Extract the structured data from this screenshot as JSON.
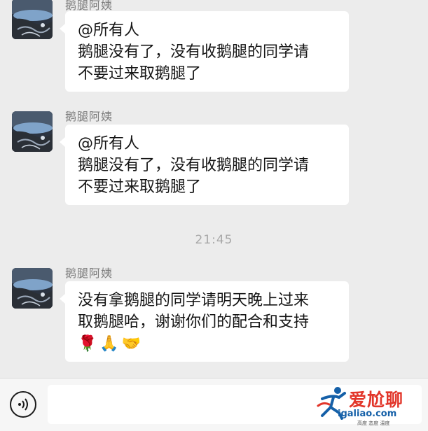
{
  "messages": [
    {
      "sender": "鹅腿阿姨",
      "lines": [
        "@所有人",
        "鹅腿没有了，没有收鹅腿的同学请",
        "不要过来取鹅腿了"
      ]
    },
    {
      "sender": "鹅腿阿姨",
      "lines": [
        "@所有人",
        "鹅腿没有了，没有收鹅腿的同学请",
        "不要过来取鹅腿了"
      ]
    },
    {
      "sender": "鹅腿阿姨",
      "lines": [
        "没有拿鹅腿的同学请明天晚上过来",
        "取鹅腿哈，谢谢你们的配合和支持"
      ],
      "emojis": [
        "🌹",
        "🙏",
        "🤝"
      ]
    }
  ],
  "timestamp": "21:45",
  "input_bar": {
    "voice_icon": "voice-icon",
    "input_value": ""
  },
  "watermark": {
    "brand": "爱尬聊",
    "url": "igaliao.com",
    "tagline": "高度 态度 温度"
  },
  "colors": {
    "chat_background": "#ececec",
    "bubble": "#ffffff",
    "watermark_red": "#e2362a",
    "watermark_blue": "#1560a8"
  }
}
